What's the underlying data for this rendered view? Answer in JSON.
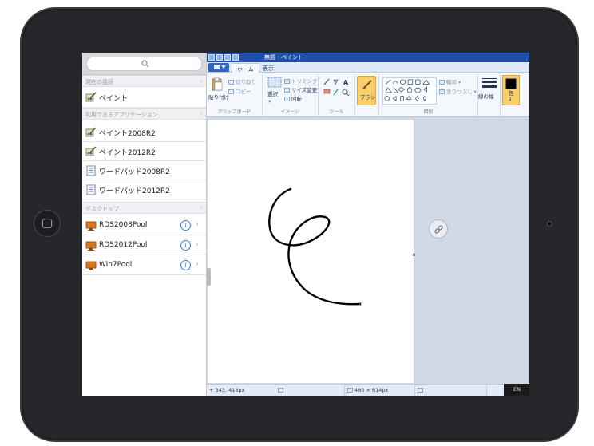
{
  "sidebar": {
    "search_placeholder": "",
    "sections": [
      {
        "header": "現在の接続"
      },
      {
        "header": "利用できるアプリケーション"
      },
      {
        "header": "デスクトップ"
      }
    ],
    "current": [
      {
        "label": "ペイント",
        "icon": "paint-app-icon"
      }
    ],
    "apps": [
      {
        "label": "ペイント2008R2",
        "icon": "paint-app-icon"
      },
      {
        "label": "ペイント2012R2",
        "icon": "paint-app-icon"
      },
      {
        "label": "ワードパッド2008R2",
        "icon": "wordpad-app-icon"
      },
      {
        "label": "ワードパッド2012R2",
        "icon": "wordpad-app-icon"
      }
    ],
    "desktops": [
      {
        "label": "RDS2008Pool",
        "icon": "desktop-pool-icon"
      },
      {
        "label": "RDS2012Pool",
        "icon": "desktop-pool-icon"
      },
      {
        "label": "Win7Pool",
        "icon": "desktop-pool-icon"
      }
    ],
    "info_glyph": "i",
    "chevron_glyph": "›"
  },
  "paint": {
    "title": "無題 - ペイント",
    "tabs": [
      {
        "label": "ホーム",
        "active": true
      },
      {
        "label": "表示",
        "active": false
      }
    ],
    "ribbon": {
      "clipboard": {
        "label": "クリップボード",
        "paste": "貼り付け",
        "cut": "切り取り",
        "copy": "コピー"
      },
      "image": {
        "label": "イメージ",
        "select": "選択",
        "crop": "トリミング",
        "resize": "サイズ変更",
        "rotate": "回転"
      },
      "tools": {
        "label": "ツール"
      },
      "brush": {
        "label": "ブラシ"
      },
      "shapes": {
        "label": "図形",
        "outline": "輪郭",
        "fill": "塗りつぶし"
      },
      "size": {
        "label": "線の幅"
      },
      "color": {
        "label": "色\n1"
      }
    },
    "status": {
      "cursor_pos": "343, 418px",
      "canvas_size": "460 × 614px"
    },
    "lang": "EN"
  },
  "colors": {
    "accent_blue": "#1f4fa8",
    "ribbon_bg": "#f4f7fc",
    "selected_brush": "#f9cf6b",
    "color1": "#000000"
  }
}
